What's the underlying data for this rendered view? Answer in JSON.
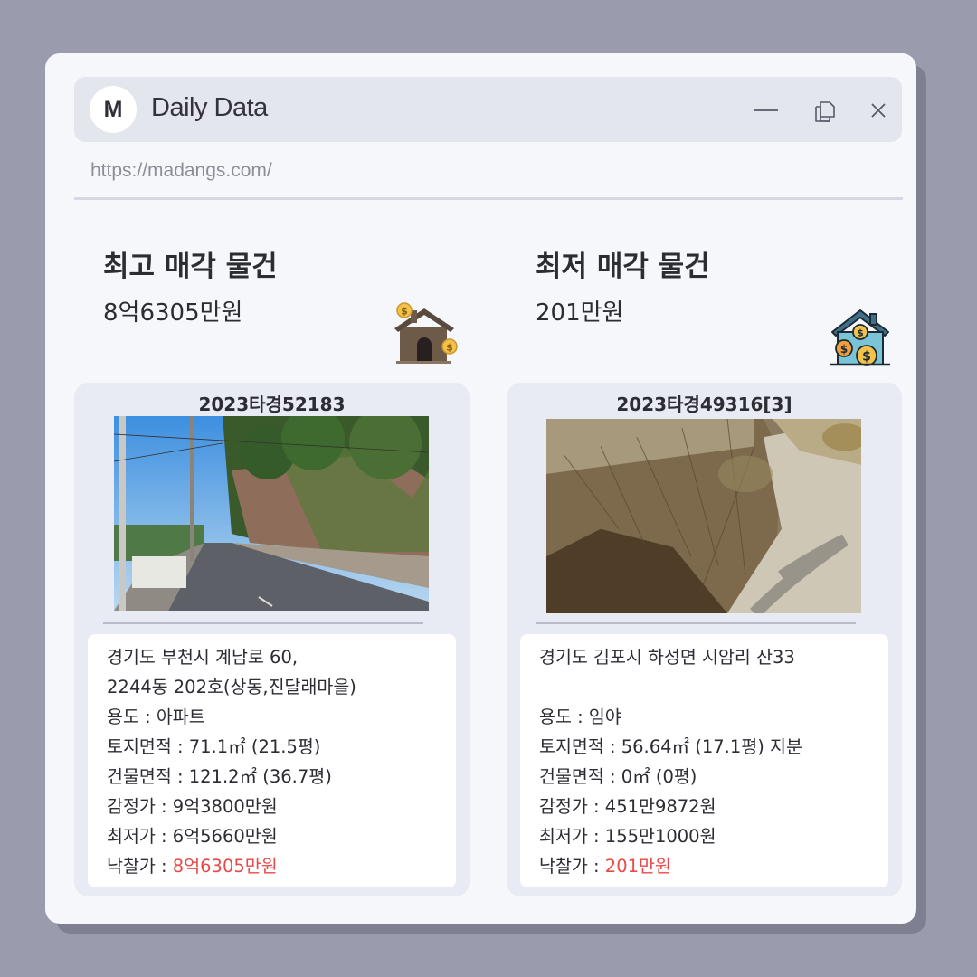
{
  "window": {
    "avatar_letter": "M",
    "title": "Daily Data",
    "url": "https://madangs.com/",
    "controls": [
      "minimize-icon",
      "restore-icon",
      "close-icon"
    ]
  },
  "highest": {
    "heading": "최고 매각 물건",
    "amount": "8억6305만원",
    "icon": "house-coins-icon",
    "case_no": "2023타경52183",
    "address1": "경기도 부천시 계남로 60,",
    "address2": "2244동 202호(상동,진달래마을)",
    "usage": "용도 : 아파트",
    "land_area": "토지면적 : 71.1㎡ (21.5평)",
    "building_area": "건물면적 : 121.2㎡ (36.7평)",
    "appraisal": "감정가 : 9억3800만원",
    "minimum": "최저가 : 6억5660만원",
    "winning_label": "낙찰가 : ",
    "winning_value": "8억6305만원"
  },
  "lowest": {
    "heading": "최저 매각 물건",
    "amount": "201만원",
    "icon": "house-money-icon",
    "case_no": "2023타경49316[3]",
    "address1": "경기도 김포시 하성면 시암리 산33",
    "address2": "",
    "usage": "용도 : 임야",
    "land_area": "토지면적 :  56.64㎡ (17.1평) 지분",
    "building_area": "건물면적 : 0㎡ (0평)",
    "appraisal": "감정가 : 451만9872원",
    "minimum": "최저가 : 155만1000원",
    "winning_label": "낙찰가 : ",
    "winning_value": "201만원"
  },
  "colors": {
    "background": "#9a9cae",
    "window": "#f6f7fb",
    "titlebar": "#e4e6ee",
    "card": "#e8eaf4",
    "accent_red": "#e84a4a"
  }
}
